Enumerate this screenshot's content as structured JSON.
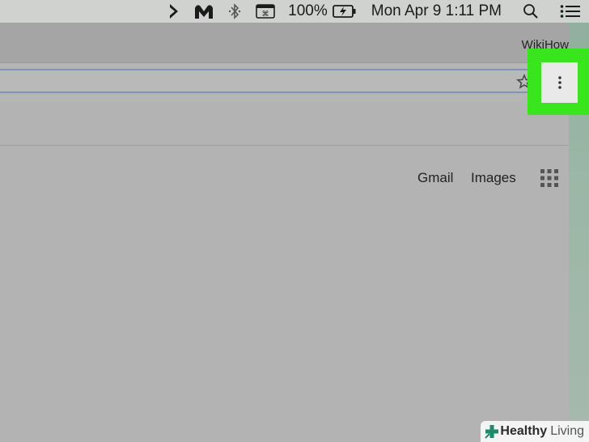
{
  "menubar": {
    "battery": "100%",
    "datetime": "Mon Apr 9  1:11 PM",
    "icons": [
      "chevron-right-icon",
      "malwarebytes-icon",
      "bluetooth-icon",
      "keyboard-icon",
      "battery-charging-icon",
      "spotlight-search-icon",
      "notification-center-icon"
    ]
  },
  "browser": {
    "profile_name": "WikiHow",
    "links": {
      "gmail": "Gmail",
      "images": "Images"
    },
    "icons": [
      "bookmark-star-icon",
      "apps-grid-icon",
      "more-options-icon"
    ]
  },
  "highlight": {
    "color": "#39e51d"
  },
  "watermark": {
    "bold": "Healthy",
    "light": "Living",
    "logo_color": "#1b8a6e"
  }
}
